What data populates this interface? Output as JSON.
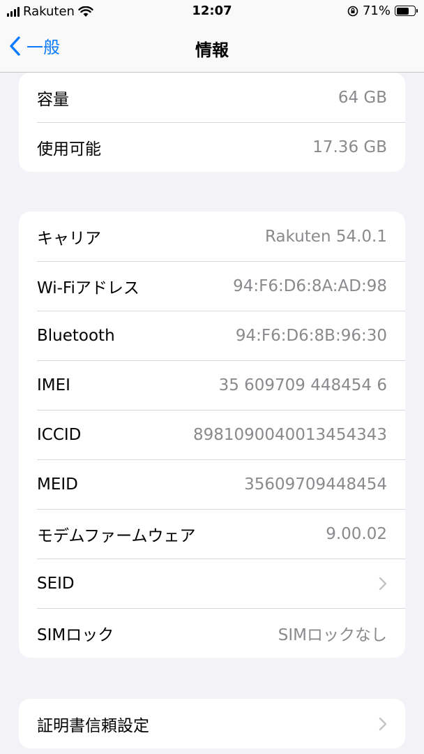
{
  "status_bar": {
    "carrier": "Rakuten",
    "time": "12:07",
    "battery_percent": "71%",
    "battery_level": 0.71
  },
  "nav": {
    "back_label": "一般",
    "title": "情報"
  },
  "storage_group": {
    "rows": [
      {
        "label": "容量",
        "value": "64 GB"
      },
      {
        "label": "使用可能",
        "value": "17.36 GB"
      }
    ]
  },
  "network_group": {
    "rows": [
      {
        "label": "キャリア",
        "value": "Rakuten 54.0.1"
      },
      {
        "label": "Wi-Fiアドレス",
        "value": "94:F6:D6:8A:AD:98"
      },
      {
        "label": "Bluetooth",
        "value": "94:F6:D6:8B:96:30"
      },
      {
        "label": "IMEI",
        "value": "35 609709 448454 6"
      },
      {
        "label": "ICCID",
        "value": "8981090040013454343"
      },
      {
        "label": "MEID",
        "value": "35609709448454"
      },
      {
        "label": "モデムファームウェア",
        "value": "9.00.02"
      },
      {
        "label": "SEID",
        "value": ""
      },
      {
        "label": "SIMロック",
        "value": "SIMロックなし"
      }
    ]
  },
  "certificate_group": {
    "rows": [
      {
        "label": "証明書信頼設定"
      }
    ]
  },
  "colors": {
    "accent": "#0a7aff",
    "background": "#f2f2f7",
    "secondary_text": "#8a8a8e"
  }
}
